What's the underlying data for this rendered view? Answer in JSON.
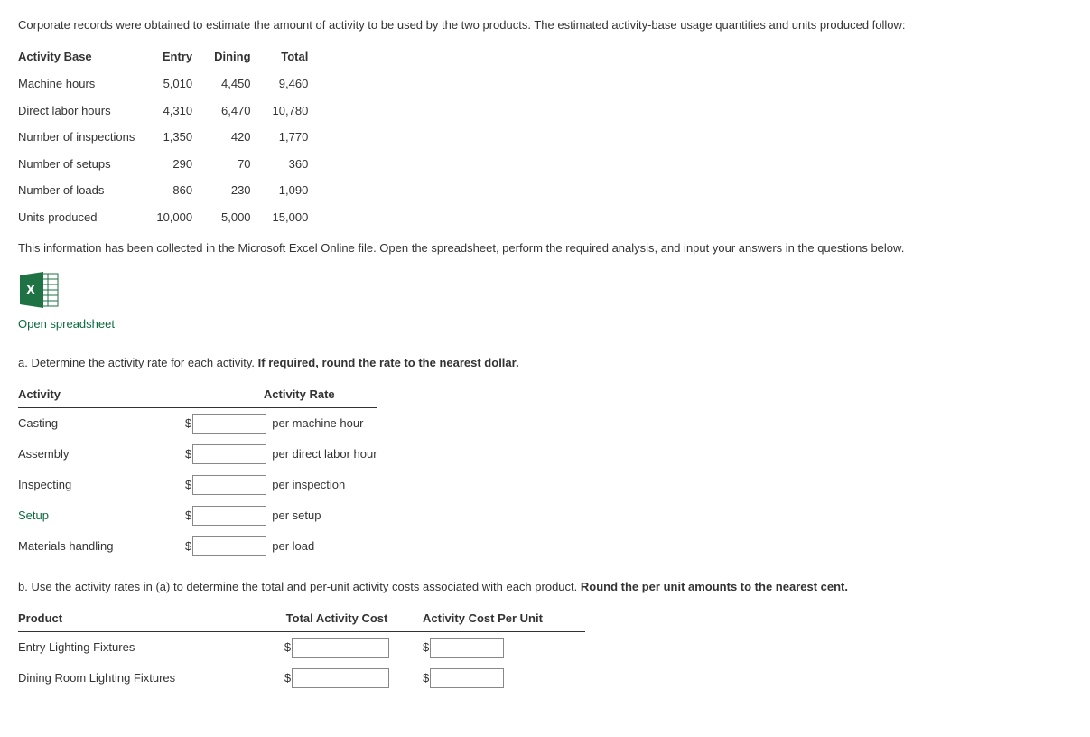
{
  "intro": "Corporate records were obtained to estimate the amount of activity to be used by the two products. The estimated activity-base usage quantities and units produced follow:",
  "activity_base": {
    "headers": {
      "c0": "Activity Base",
      "c1": "Entry",
      "c2": "Dining",
      "c3": "Total"
    },
    "rows": [
      {
        "label": "Machine hours",
        "entry": "5,010",
        "dining": "4,450",
        "total": "9,460"
      },
      {
        "label": "Direct labor hours",
        "entry": "4,310",
        "dining": "6,470",
        "total": "10,780"
      },
      {
        "label": "Number of inspections",
        "entry": "1,350",
        "dining": "420",
        "total": "1,770"
      },
      {
        "label": "Number of setups",
        "entry": "290",
        "dining": "70",
        "total": "360"
      },
      {
        "label": "Number of loads",
        "entry": "860",
        "dining": "230",
        "total": "1,090"
      },
      {
        "label": "Units produced",
        "entry": "10,000",
        "dining": "5,000",
        "total": "15,000"
      }
    ]
  },
  "note": "This information has been collected in the Microsoft Excel Online file. Open the spreadsheet, perform the required analysis, and input your answers in the questions below.",
  "open_link": "Open spreadsheet",
  "part_a": {
    "letter": "a.",
    "text_plain": "  Determine the activity rate for each activity. ",
    "text_bold": "If required, round the rate to the nearest dollar.",
    "headers": {
      "c0": "Activity",
      "c1": "Activity Rate"
    },
    "rows": [
      {
        "label": "Casting",
        "unit": "per machine hour"
      },
      {
        "label": "Assembly",
        "unit": "per direct labor hour"
      },
      {
        "label": "Inspecting",
        "unit": "per inspection"
      },
      {
        "label": "Setup",
        "unit": "per setup"
      },
      {
        "label": "Materials handling",
        "unit": "per load"
      }
    ]
  },
  "part_b": {
    "letter": "b.",
    "text_plain": "  Use the activity rates in (a) to determine the total and per-unit activity costs associated with each product. ",
    "text_bold": "Round the per unit amounts to the nearest cent.",
    "headers": {
      "c0": "Product",
      "c1": "Total Activity Cost",
      "c2": "Activity Cost Per Unit"
    },
    "rows": [
      {
        "label": "Entry Lighting Fixtures"
      },
      {
        "label": "Dining Room Lighting Fixtures"
      }
    ]
  },
  "symbols": {
    "dollar": "$"
  }
}
